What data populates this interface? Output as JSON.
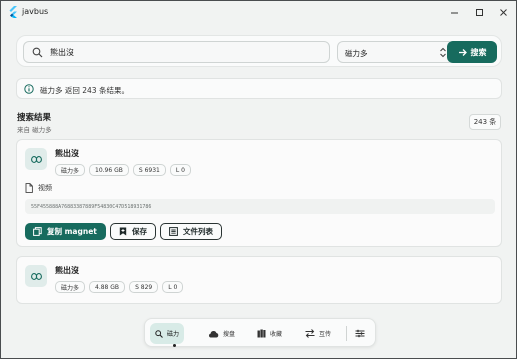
{
  "window": {
    "title": "javbus"
  },
  "search": {
    "query": "熊出沒",
    "placeholder": "",
    "engine": "磁力多",
    "button_label": "搜索"
  },
  "info": {
    "message": "磁力多 返回 243 条结果。"
  },
  "results": {
    "title": "搜索结果",
    "source": "来自 磁力多",
    "count": "243 条"
  },
  "cards": [
    {
      "name": "熊出沒",
      "tags": [
        "磁力多",
        "10.96 GB",
        "S 6931",
        "L 0"
      ],
      "file_label": "视频",
      "hash": "55F455888A76883387889F54830C47D518931786",
      "actions": {
        "copy": "复制 magnet",
        "save": "保存",
        "files": "文件列表"
      }
    },
    {
      "name": "熊出沒",
      "tags": [
        "磁力多",
        "4.88 GB",
        "S 829",
        "L 0"
      ]
    }
  ],
  "nav": {
    "magnet": "磁力",
    "cloud": "搜盘",
    "favorites": "收藏",
    "relay": "互传"
  },
  "colors": {
    "accent": "#176b5e",
    "accent_light": "#d8ebe7",
    "background": "#f1f3f2"
  }
}
